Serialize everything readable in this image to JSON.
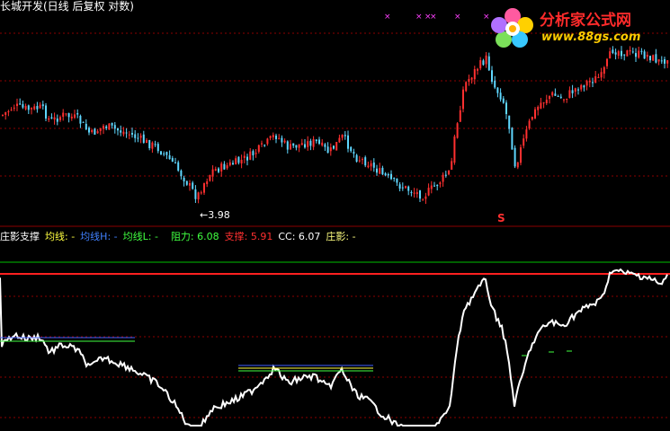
{
  "title": "长城开发(日线 后复权 对数)",
  "low_label": "3.98",
  "signal_mark": "S",
  "legend": {
    "name": "庄影支撑",
    "ma": "均线: -",
    "ma_h": "均线H: -",
    "ma_l": "均线L: -",
    "resist": "阻力: 6.08",
    "support": "支撑: 5.91",
    "cc": "CC: 6.07",
    "shadow": "庄影: -"
  },
  "logo": {
    "name": "分析家公式网",
    "url": "www.88gs.com"
  },
  "colors": {
    "background": "#000000",
    "up_candle": "#ff3030",
    "down_candle": "#5fd7ff",
    "grid": "#8b0000",
    "resist_line": "#00c000",
    "support_line": "#ff2020",
    "indicator_line": "#ffffff",
    "ma_h": "#4060ff",
    "ma_l": "#40ff40",
    "ma": "#ffff40",
    "magenta_marks": "#ff40ff"
  }
}
